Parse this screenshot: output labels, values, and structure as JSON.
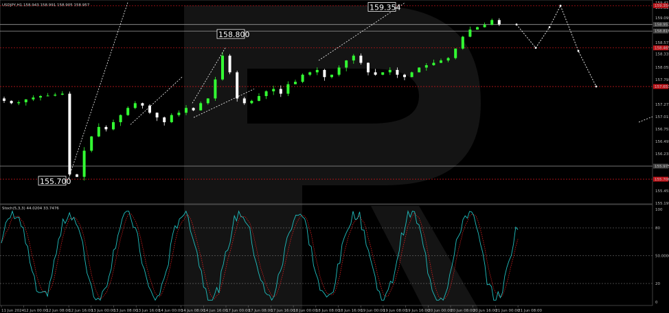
{
  "window": {
    "title": "USDJPY,H1",
    "ohlc": "158.943 158.991 158.905 158.957"
  },
  "oscillator": {
    "title": "Stoch(5,3,3) 44.0204 33.7476",
    "levels": [
      "100",
      "80",
      "50.0000",
      "20",
      "0"
    ]
  },
  "price_axis": [
    "159.415",
    "159.315",
    "159.095",
    "158.957",
    "158.819",
    "158.575",
    "158.465",
    "158.335",
    "158.055",
    "157.795",
    "157.651",
    "157.275",
    "157.015",
    "156.755",
    "156.495",
    "156.235",
    "155.975",
    "155.700",
    "155.455",
    "155.195"
  ],
  "price_badges": [
    {
      "text": "159.354",
      "color": "#c0141a"
    },
    {
      "text": "158.957",
      "color": "#444444"
    },
    {
      "text": "158.819",
      "color": "#444444"
    },
    {
      "text": "158.465",
      "color": "#c0141a"
    },
    {
      "text": "157.651",
      "color": "#c0141a"
    },
    {
      "text": "155.975",
      "color": "#444444"
    },
    {
      "text": "155.700",
      "color": "#c0141a"
    }
  ],
  "time_axis": [
    "11 Jun 2024",
    "12 Jun 00:00",
    "12 Jun 08:00",
    "12 Jun 16:00",
    "13 Jun 00:00",
    "13 Jun 08:00",
    "13 Jun 16:00",
    "14 Jun 00:00",
    "14 Jun 08:00",
    "14 Jun 16:00",
    "17 Jun 00:00",
    "17 Jun 08:00",
    "17 Jun 16:00",
    "18 Jun 00:00",
    "18 Jun 08:00",
    "18 Jun 16:00",
    "19 Jun 00:00",
    "19 Jun 08:00",
    "19 Jun 16:00",
    "20 Jun 00:00",
    "20 Jun 08:00",
    "20 Jun 16:00",
    "21 Jun 00:00",
    "21 Jun 08:00"
  ],
  "annotations": [
    {
      "text": "159.354"
    },
    {
      "text": "158.800"
    },
    {
      "text": "155.700"
    }
  ],
  "colors": {
    "bull": "#33ff33",
    "bear": "#ffffff",
    "stoch_main": "#20c0c0",
    "stoch_signal": "#e02020",
    "level_red": "#c0141a",
    "level_white": "#9a9a9a"
  },
  "chart_data": {
    "type": "candlestick",
    "symbol": "USDJPY",
    "timeframe": "H1",
    "price_range": [
      155.195,
      159.415
    ],
    "resistance_levels": [
      159.354,
      158.957,
      158.819,
      158.465,
      157.651
    ],
    "support_levels": [
      155.975,
      155.7
    ],
    "key_prices": [
      159.354,
      158.8,
      155.7
    ],
    "close_path": [
      157.4,
      157.35,
      157.3,
      157.32,
      157.38,
      157.42,
      157.45,
      157.46,
      157.48,
      157.5,
      155.8,
      155.75,
      156.3,
      156.6,
      156.8,
      156.75,
      156.9,
      157.05,
      157.2,
      157.3,
      157.25,
      157.1,
      157.0,
      156.9,
      157.05,
      157.1,
      157.2,
      157.15,
      157.3,
      157.4,
      157.8,
      158.3,
      157.95,
      157.4,
      157.3,
      157.35,
      157.45,
      157.55,
      157.6,
      157.5,
      157.7,
      157.75,
      157.9,
      157.95,
      158.0,
      157.85,
      157.9,
      158.05,
      158.2,
      158.3,
      158.15,
      157.95,
      157.9,
      157.95,
      158.0,
      157.9,
      157.85,
      157.95,
      158.05,
      158.1,
      158.15,
      158.2,
      158.25,
      158.45,
      158.7,
      158.85,
      158.9,
      158.95,
      159.05,
      158.957
    ],
    "forecast_path": [
      158.957,
      158.465,
      158.9,
      159.354,
      158.4,
      157.651
    ],
    "stochastic": {
      "main": 44.0204,
      "signal": 33.7476,
      "levels": [
        20,
        50,
        80
      ]
    }
  }
}
